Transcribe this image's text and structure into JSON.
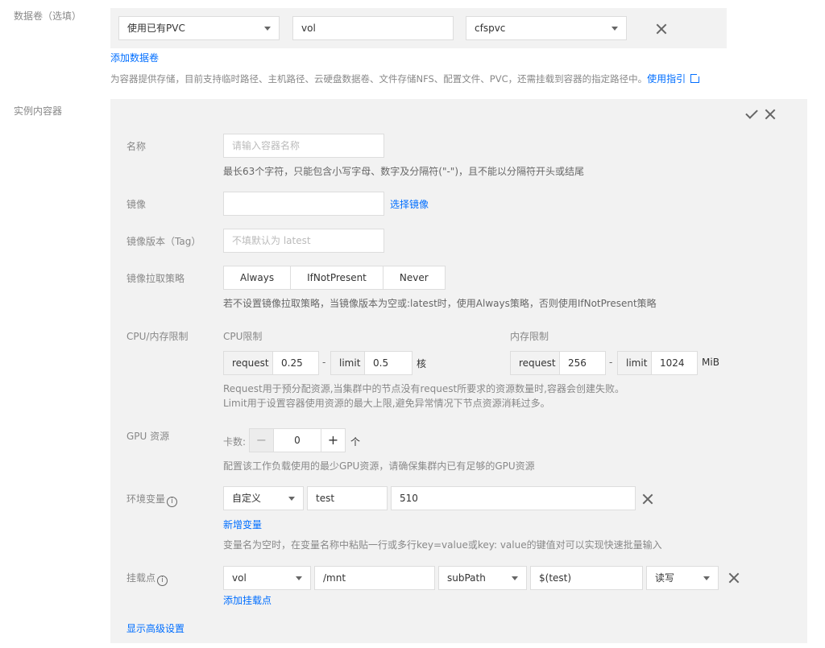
{
  "volumes": {
    "label": "数据卷（选填）",
    "type_select": "使用已有PVC",
    "name_value": "vol",
    "pvc_select": "cfspvc",
    "add_link": "添加数据卷",
    "hint": "为容器提供存储，目前支持临时路径、主机路径、云硬盘数据卷、文件存储NFS、配置文件、PVC，还需挂载到容器的指定路径中。",
    "guide_link": "使用指引"
  },
  "container": {
    "label": "实例内容器",
    "name": {
      "label": "名称",
      "placeholder": "请输入容器名称",
      "hint": "最长63个字符，只能包含小写字母、数字及分隔符(\"-\")，且不能以分隔符开头或结尾"
    },
    "image": {
      "label": "镜像",
      "value": "",
      "select_link": "选择镜像"
    },
    "tag": {
      "label": "镜像版本（Tag）",
      "placeholder": "不填默认为 latest"
    },
    "pull_policy": {
      "label": "镜像拉取策略",
      "options": [
        "Always",
        "IfNotPresent",
        "Never"
      ],
      "hint": "若不设置镜像拉取策略，当镜像版本为空或:latest时，使用Always策略，否则使用IfNotPresent策略"
    },
    "cpu_mem": {
      "label": "CPU/内存限制",
      "cpu_title": "CPU限制",
      "mem_title": "内存限制",
      "request_label": "request",
      "limit_label": "limit",
      "cpu_request": "0.25",
      "cpu_limit": "0.5",
      "cpu_unit": "核",
      "mem_request": "256",
      "mem_limit": "1024",
      "mem_unit": "MiB",
      "dash": "-",
      "hint_line1": "Request用于预分配资源,当集群中的节点没有request所要求的资源数量时,容器会创建失败。",
      "hint_line2": "Limit用于设置容器使用资源的最大上限,避免异常情况下节点资源消耗过多。"
    },
    "gpu": {
      "label": "GPU 资源",
      "count_label": "卡数:",
      "minus": "−",
      "value": "0",
      "plus": "+",
      "unit": "个",
      "hint": "配置该工作负载使用的最少GPU资源，请确保集群内已有足够的GPU资源"
    },
    "env": {
      "label": "环境变量",
      "type_select": "自定义",
      "key": "test",
      "value": "510",
      "add_link": "新增变量",
      "hint": "变量名为空时，在变量名称中粘贴一行或多行key=value或key: value的键值对可以实现快速批量输入"
    },
    "mount": {
      "label": "挂载点",
      "volume_select": "vol",
      "path": "/mnt",
      "subpath_select": "subPath",
      "subpath_value": "$(test)",
      "mode_select": "读写",
      "add_link": "添加挂载点"
    },
    "advanced_link": "显示高级设置"
  }
}
